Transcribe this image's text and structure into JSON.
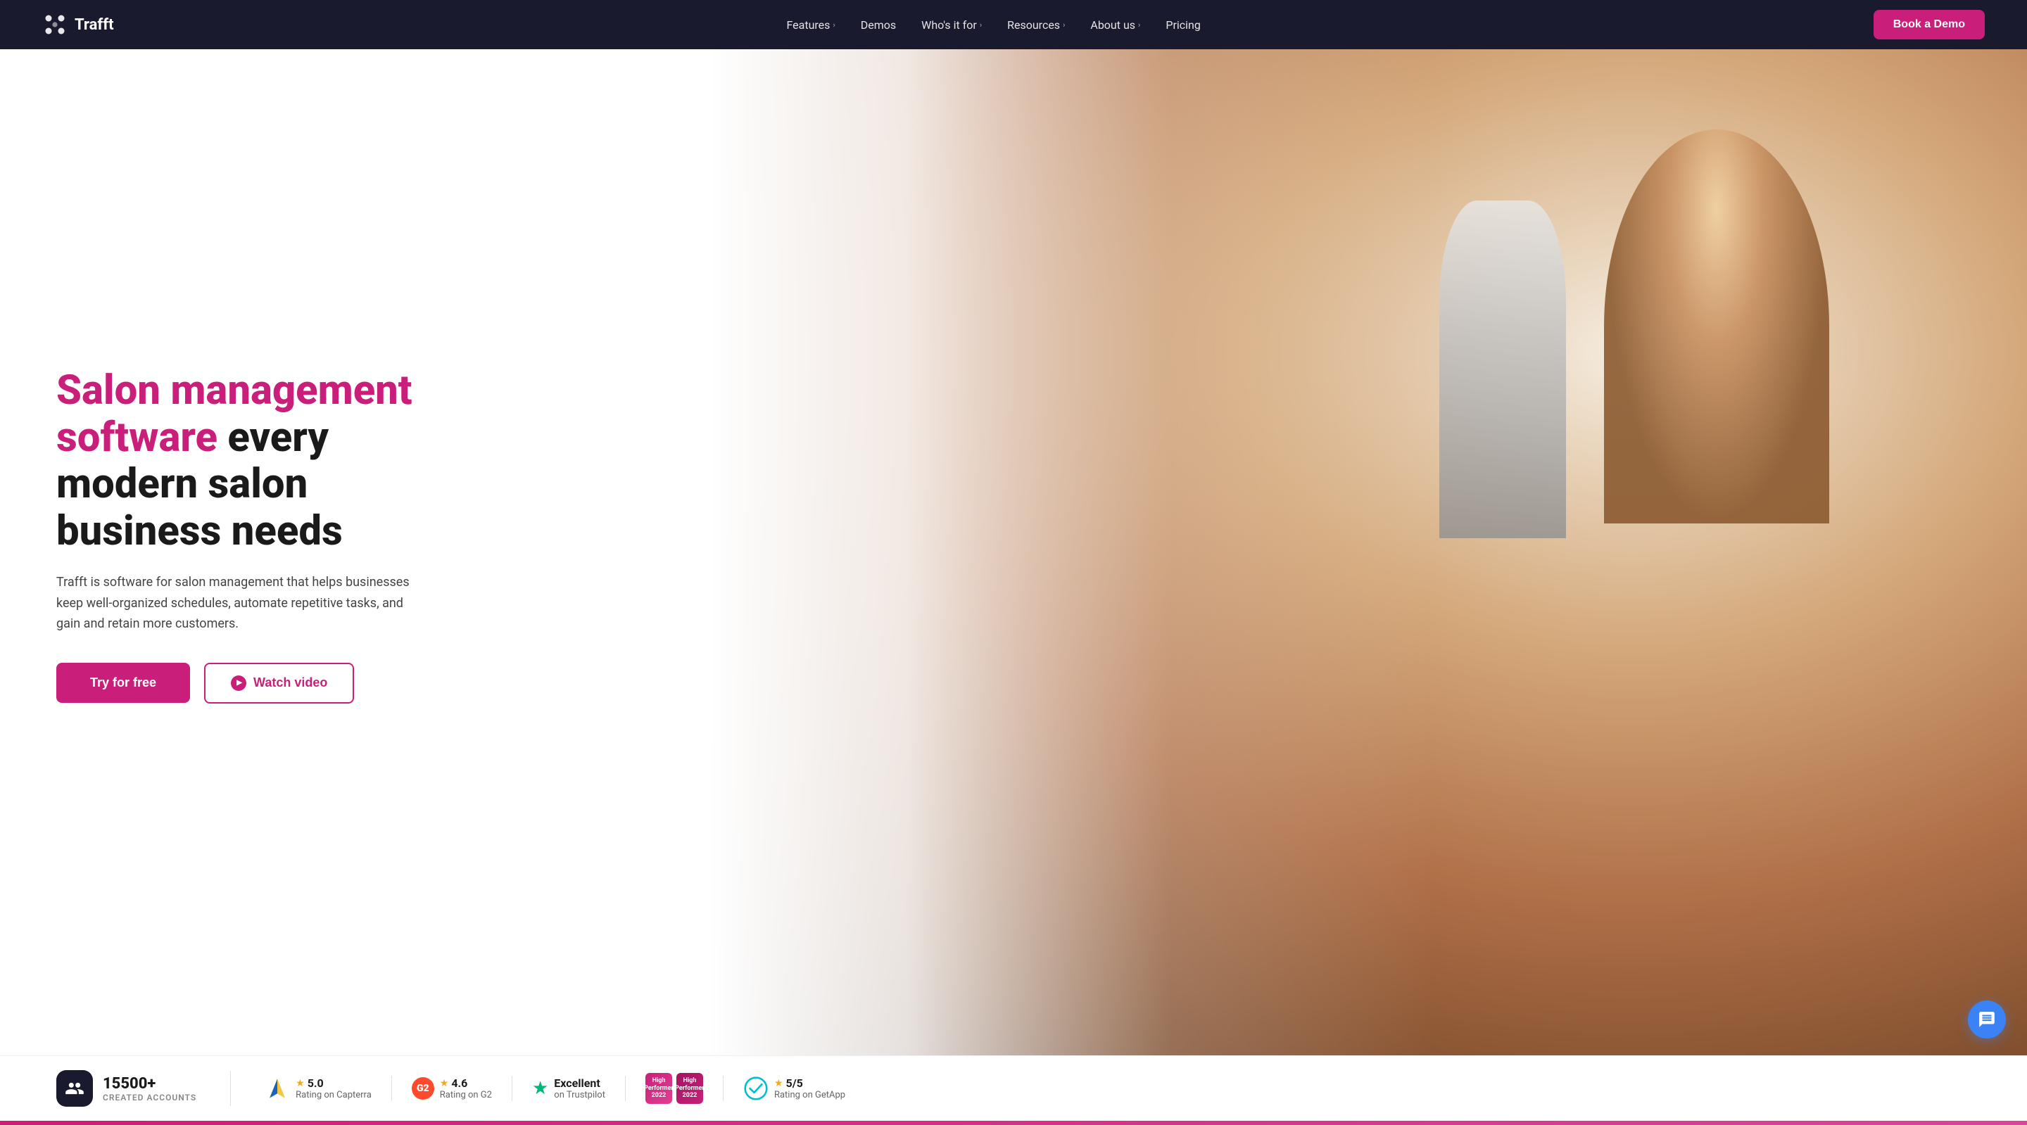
{
  "brand": {
    "name": "Trafft",
    "logo_alt": "Trafft logo"
  },
  "navbar": {
    "links": [
      {
        "label": "Features",
        "has_dropdown": true
      },
      {
        "label": "Demos",
        "has_dropdown": false
      },
      {
        "label": "Who's it for",
        "has_dropdown": true
      },
      {
        "label": "Resources",
        "has_dropdown": true
      },
      {
        "label": "About us",
        "has_dropdown": true
      },
      {
        "label": "Pricing",
        "has_dropdown": false
      }
    ],
    "cta": "Book a Demo"
  },
  "hero": {
    "title_highlight": "Salon management software",
    "title_rest": " every modern salon business needs",
    "subtitle": "Trafft is software for salon management that helps businesses keep well-organized schedules, automate repetitive tasks, and gain and retain more customers.",
    "btn_try": "Try for free",
    "btn_watch": "Watch video"
  },
  "stats": {
    "accounts_number": "15500+",
    "accounts_label": "CREATED ACCOUNTS",
    "ratings": [
      {
        "platform": "Capterra",
        "score": "5.0",
        "label": "Rating on Capterra",
        "icon_type": "capterra"
      },
      {
        "platform": "G2",
        "score": "4.6",
        "label": "Rating on G2",
        "icon_type": "g2"
      },
      {
        "platform": "Trustpilot",
        "score": "Excellent",
        "label": "on Trustpilot",
        "icon_type": "trustpilot"
      },
      {
        "platform": "GetApp",
        "score": "5/5",
        "label": "Rating on GetApp",
        "icon_type": "getapp"
      }
    ],
    "badges": [
      "High Performer 2022",
      "High Performer 2022"
    ]
  }
}
